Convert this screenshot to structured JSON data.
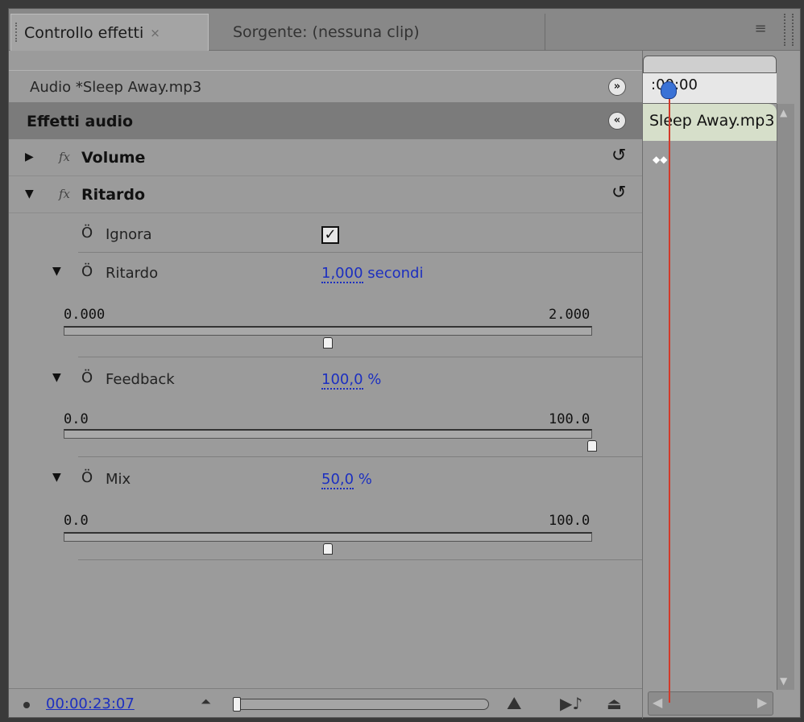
{
  "tabs": [
    {
      "label": "Controllo effetti",
      "close": "×"
    },
    {
      "label": "Sorgente: (nessuna clip)"
    }
  ],
  "panel_menu_icon": "≡",
  "clip_title": "Audio *Sleep Away.mp3",
  "section_title": "Effetti audio",
  "effects": {
    "volume": {
      "name": "Volume",
      "fx": "fx"
    },
    "delay": {
      "name": "Ritardo",
      "fx": "fx"
    }
  },
  "params": {
    "bypass": {
      "name": "Ignora",
      "checked": true
    },
    "delay_time": {
      "name": "Ritardo",
      "value": "1,000",
      "unit": " secondi",
      "min": "0.000",
      "max": "2.000",
      "fraction": 0.5
    },
    "feedback": {
      "name": "Feedback",
      "value": "100,0",
      "unit": " %",
      "min": "0.0",
      "max": "100.0",
      "fraction": 1.0
    },
    "mix": {
      "name": "Mix",
      "value": "50,0",
      "unit": " %",
      "min": "0.0",
      "max": "100.0",
      "fraction": 0.5
    }
  },
  "footer": {
    "timecode": "00:00:23:07"
  },
  "timeline": {
    "time_label": ":00:00",
    "clip_label": "Sleep Away.mp3"
  },
  "icons": {
    "expand": "▶",
    "collapse": "▼",
    "stopwatch": "Ö",
    "reset": "↺",
    "show_hide": "»",
    "collapse_section": "«"
  }
}
